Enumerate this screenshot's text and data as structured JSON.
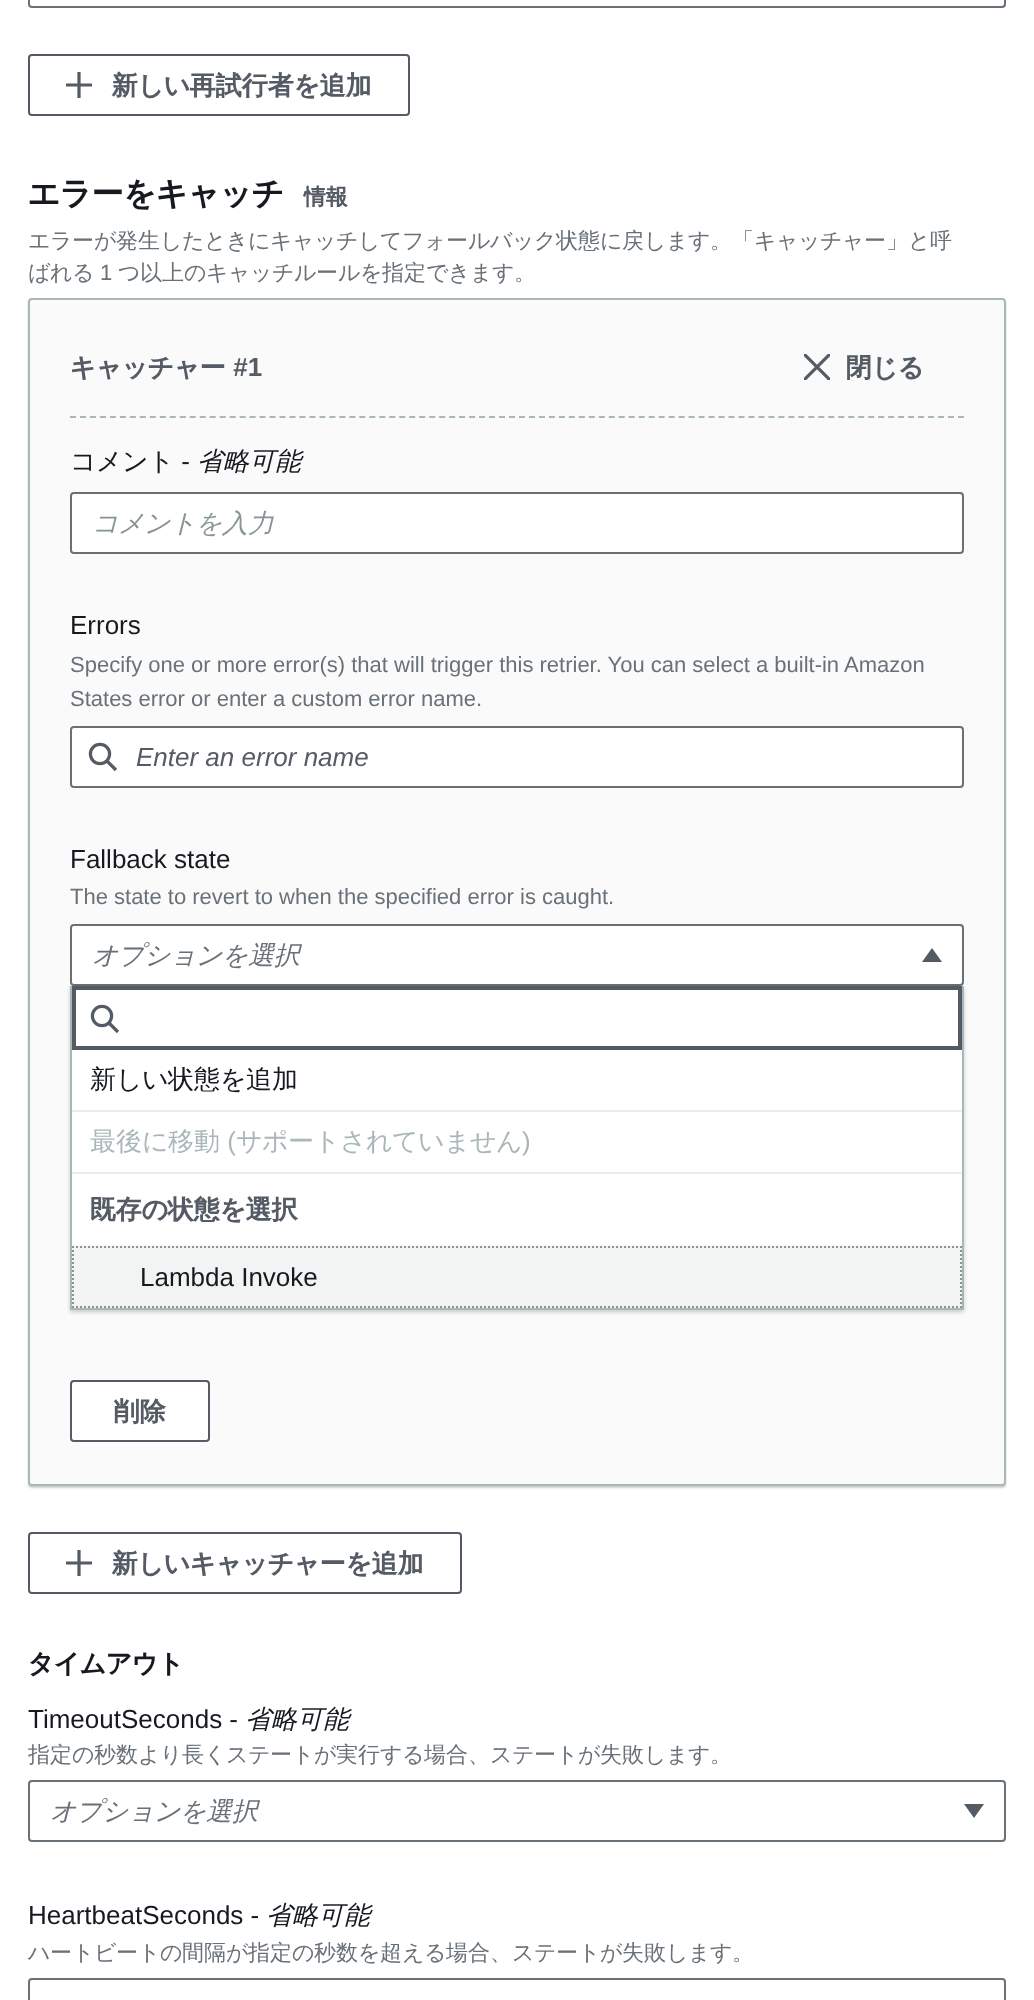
{
  "add_retrier_button": {
    "label": "新しい再試行者を追加"
  },
  "catch_section": {
    "title": "エラーをキャッチ",
    "info_link": "情報",
    "description": "エラーが発生したときにキャッチしてフォールバック状態に戻します。「キャッチャー」と呼ばれる 1 つ以上のキャッチルールを指定できます。",
    "catchers": [
      {
        "title": "キャッチャー #1",
        "close_label": "閉じる",
        "fields": [
          {
            "kind": "text",
            "label": "コメント - *省略可能*",
            "placeholder": "コメントを入力"
          },
          {
            "kind": "search",
            "label": "Errors",
            "description": "Specify one or more error(s) that will trigger this retrier. You can select a built-in Amazon States error or enter a custom error name.",
            "placeholder": "Enter an error name"
          },
          {
            "kind": "select",
            "label": "Fallback state",
            "description": "The state to revert to when the specified error is caught.",
            "placeholder": "オプションを選択",
            "expanded": true,
            "options": [
              {
                "label": "新しい状態を追加",
                "disabled": false
              },
              {
                "label": "最後に移動 (サポートされていません)",
                "disabled": true
              }
            ],
            "group": {
              "label": "既存の状態を選択",
              "options": [
                {
                  "label": "Lambda Invoke",
                  "highlighted": true
                }
              ]
            }
          }
        ],
        "delete_button": "削除"
      }
    ],
    "add_catcher_button": {
      "label": "新しいキャッチャーを追加"
    }
  },
  "timeout": {
    "title": "タイムアウト",
    "fields": [
      {
        "label": "TimeoutSeconds - *省略可能*",
        "description": "指定の秒数より長くステートが実行する場合、ステートが失敗します。",
        "placeholder": "オプションを選択",
        "expanded": false
      },
      {
        "label": "HeartbeatSeconds - *省略可能*",
        "description": "ハートビートの間隔が指定の秒数を超える場合、ステートが失敗します。"
      }
    ]
  }
}
